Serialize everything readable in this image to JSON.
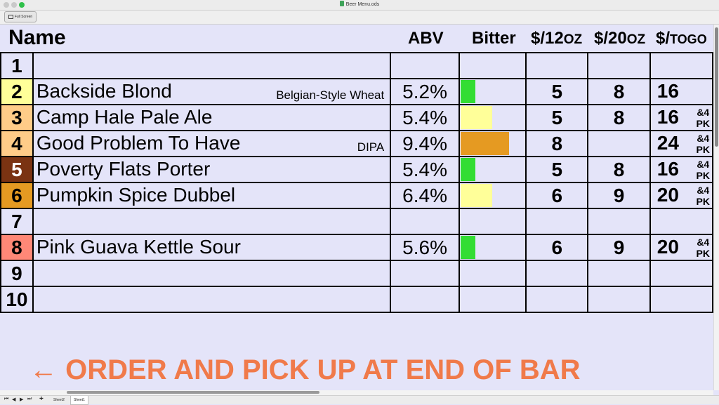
{
  "window": {
    "title": "Beer Menu.ods"
  },
  "toolbar": {
    "fullscreen_label": "Full Screen"
  },
  "headers": {
    "name": "Name",
    "abv": "ABV",
    "bitter": "Bitter",
    "p12_prefix": "$/12",
    "p12_unit": "OZ",
    "p20_prefix": "$/20",
    "p20_unit": "OZ",
    "togo_prefix": "$/",
    "togo_unit": "TOGO"
  },
  "rows": [
    {
      "num": "1",
      "num_color": "#e4e4f9",
      "num_text_color": "#000000",
      "name": "",
      "style": "",
      "abv": "",
      "bitter_fraction": 0,
      "bitter_color": "",
      "p12": "",
      "p20": "",
      "togo": "",
      "pk1": "",
      "pk2": ""
    },
    {
      "num": "2",
      "num_color": "#ffff99",
      "num_text_color": "#000000",
      "name": "Backside Blond",
      "style": "Belgian-Style Wheat",
      "abv": "5.2%",
      "bitter_fraction": 0.22,
      "bitter_color": "#33dd33",
      "p12": "5",
      "p20": "8",
      "togo": "16",
      "pk1": "",
      "pk2": ""
    },
    {
      "num": "3",
      "num_color": "#ffcc88",
      "num_text_color": "#000000",
      "name": "Camp Hale Pale Ale",
      "style": "",
      "abv": "5.4%",
      "bitter_fraction": 0.48,
      "bitter_color": "#ffff99",
      "p12": "5",
      "p20": "8",
      "togo": "16",
      "pk1": "&4",
      "pk2": "PK"
    },
    {
      "num": "4",
      "num_color": "#ffcc88",
      "num_text_color": "#000000",
      "name": "Good Problem To Have",
      "style": "DIPA",
      "abv": "9.4%",
      "bitter_fraction": 0.74,
      "bitter_color": "#e59a22",
      "p12": "8",
      "p20": "",
      "togo": "24",
      "pk1": "&4",
      "pk2": "PK"
    },
    {
      "num": "5",
      "num_color": "#7a3312",
      "num_text_color": "#ffffff",
      "name": "Poverty Flats Porter",
      "style": "",
      "abv": "5.4%",
      "bitter_fraction": 0.22,
      "bitter_color": "#33dd33",
      "p12": "5",
      "p20": "8",
      "togo": "16",
      "pk1": "&4",
      "pk2": "PK"
    },
    {
      "num": "6",
      "num_color": "#e59a22",
      "num_text_color": "#000000",
      "name": "Pumpkin Spice Dubbel",
      "style": "",
      "abv": "6.4%",
      "bitter_fraction": 0.48,
      "bitter_color": "#ffff99",
      "p12": "6",
      "p20": "9",
      "togo": "20",
      "pk1": "&4",
      "pk2": "PK"
    },
    {
      "num": "7",
      "num_color": "#e4e4f9",
      "num_text_color": "#000000",
      "name": "",
      "style": "",
      "abv": "",
      "bitter_fraction": 0,
      "bitter_color": "",
      "p12": "",
      "p20": "",
      "togo": "",
      "pk1": "",
      "pk2": ""
    },
    {
      "num": "8",
      "num_color": "#ff8877",
      "num_text_color": "#000000",
      "name": "Pink Guava Kettle Sour",
      "style": "",
      "abv": "5.6%",
      "bitter_fraction": 0.22,
      "bitter_color": "#33dd33",
      "p12": "6",
      "p20": "9",
      "togo": "20",
      "pk1": "&4",
      "pk2": "PK"
    },
    {
      "num": "9",
      "num_color": "#e4e4f9",
      "num_text_color": "#000000",
      "name": "",
      "style": "",
      "abv": "",
      "bitter_fraction": 0,
      "bitter_color": "",
      "p12": "",
      "p20": "",
      "togo": "",
      "pk1": "",
      "pk2": ""
    },
    {
      "num": "10",
      "num_color": "#e4e4f9",
      "num_text_color": "#000000",
      "name": "",
      "style": "",
      "abv": "",
      "bitter_fraction": 0,
      "bitter_color": "",
      "p12": "",
      "p20": "",
      "togo": "",
      "pk1": "",
      "pk2": ""
    }
  ],
  "footer": {
    "arrow": "←",
    "text": "ORDER AND PICK UP AT END OF BAR",
    "color": "#f07a4a"
  },
  "sheet_tabs": [
    {
      "label": "Sheet2",
      "active": false
    },
    {
      "label": "Sheet1",
      "active": true
    }
  ],
  "nav_buttons": [
    "first-sheet",
    "prev-sheet",
    "next-sheet",
    "last-sheet",
    "add-sheet"
  ]
}
